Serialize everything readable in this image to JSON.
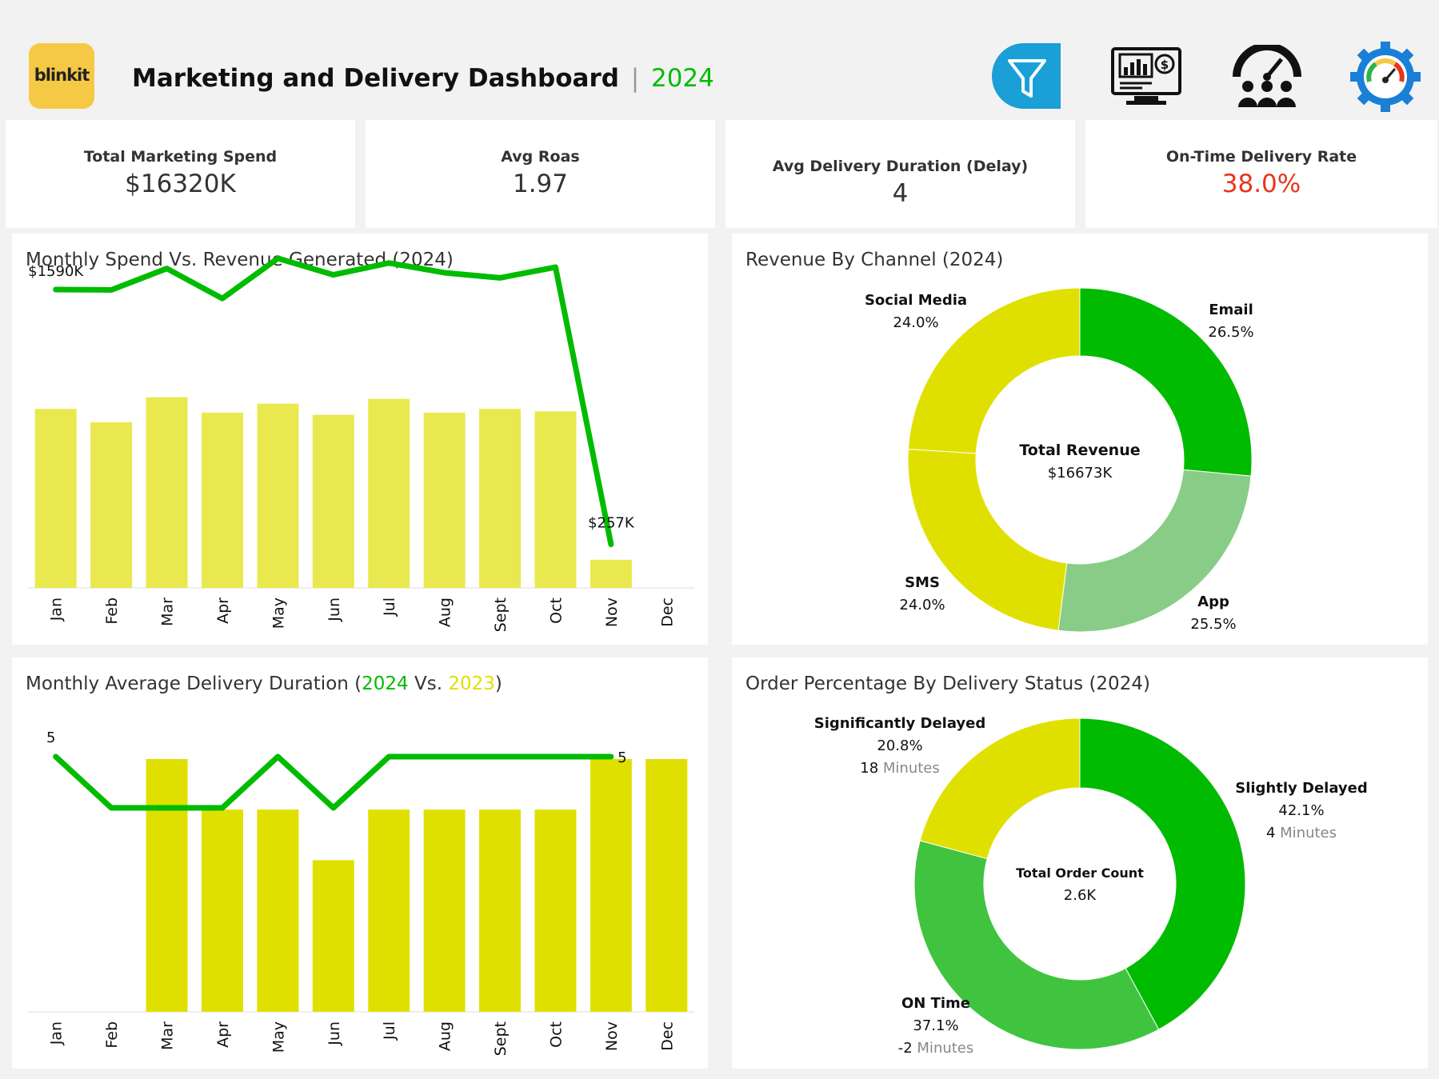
{
  "header": {
    "logo_text": "blinkit",
    "title": "Marketing and Delivery Dashboard",
    "separator": "|",
    "year": "2024",
    "icons": [
      "filter-icon",
      "monitor-dollar-icon",
      "speedometer-team-icon",
      "gear-gauge-icon"
    ]
  },
  "colors": {
    "green": "#00bb00",
    "lightgreen": "#88cc88",
    "yellow": "#e0e000",
    "lightyellow": "#e9e94f",
    "red": "#e8341c",
    "teal": "#1a9fd6",
    "logo_bg": "#f6c945"
  },
  "kpis": [
    {
      "title": "Total Marketing Spend",
      "value": "$16320K"
    },
    {
      "title": "Avg Roas",
      "value": "1.97"
    },
    {
      "title": "Avg Delivery Duration (Delay)",
      "value": "4"
    },
    {
      "title": "On-Time Delivery Rate",
      "value": "38.0%"
    }
  ],
  "chart_data": [
    {
      "type": "bar",
      "title": "Monthly Spend Vs. Revenue Generated (2024)",
      "categories": [
        "Jan",
        "Feb",
        "Mar",
        "Apr",
        "May",
        "Jun",
        "Jul",
        "Aug",
        "Sept",
        "Oct",
        "Nov",
        "Dec"
      ],
      "series": [
        {
          "kind": "bar",
          "values": [
            1305,
            1208,
            1390,
            1278,
            1343,
            1262,
            1378,
            1278,
            1305,
            1287,
            205,
            null
          ]
        },
        {
          "kind": "line",
          "values": [
            1590,
            1588,
            1700,
            1543,
            1753,
            1667,
            1729,
            1678,
            1651,
            1707,
            257,
            null
          ]
        }
      ],
      "ylim": [
        0,
        2000
      ],
      "data_labels": {
        "first": "$1590K",
        "last": "$257K"
      }
    },
    {
      "type": "donut",
      "title": "Revenue By Channel (2024)",
      "center_label": "Total Revenue",
      "center_value": "$16673K",
      "slices": [
        {
          "name": "Email",
          "percent": 26.5,
          "label": "26.5%"
        },
        {
          "name": "App",
          "percent": 25.5,
          "label": "25.5%"
        },
        {
          "name": "SMS",
          "percent": 24.0,
          "label": "24.0%"
        },
        {
          "name": "Social Media",
          "percent": 24.0,
          "label": "24.0%"
        }
      ]
    },
    {
      "type": "bar",
      "title_parts": [
        "Monthly Average Delivery Duration (",
        "2024",
        " Vs. ",
        "2023",
        ")"
      ],
      "categories": [
        "Jan",
        "Feb",
        "Mar",
        "Apr",
        "May",
        "Jun",
        "Jul",
        "Aug",
        "Sept",
        "Oct",
        "Nov",
        "Dec"
      ],
      "series": [
        {
          "kind": "bar",
          "name": "2023",
          "values": [
            null,
            null,
            5,
            4,
            4,
            3,
            4,
            4,
            4,
            4,
            5,
            5
          ]
        },
        {
          "kind": "line",
          "name": "2024",
          "values": [
            5,
            4,
            4,
            4,
            5,
            4,
            5,
            5,
            5,
            5,
            5,
            null
          ]
        }
      ],
      "ylim": [
        0,
        5
      ],
      "data_labels": {
        "first": "5",
        "last": "5"
      }
    },
    {
      "type": "donut",
      "title": "Order Percentage By Delivery Status (2024)",
      "center_label": "Total Order Count",
      "center_value": "2.6K",
      "slices": [
        {
          "name": "Slightly Delayed",
          "percent": 42.1,
          "label": "42.1%",
          "minutes": "4",
          "unit": "Minutes"
        },
        {
          "name": "ON Time",
          "percent": 37.1,
          "label": "37.1%",
          "minutes": "-2",
          "unit": "Minutes"
        },
        {
          "name": "Significantly Delayed",
          "percent": 20.8,
          "label": "20.8%",
          "minutes": "18",
          "unit": "Minutes"
        }
      ]
    }
  ]
}
